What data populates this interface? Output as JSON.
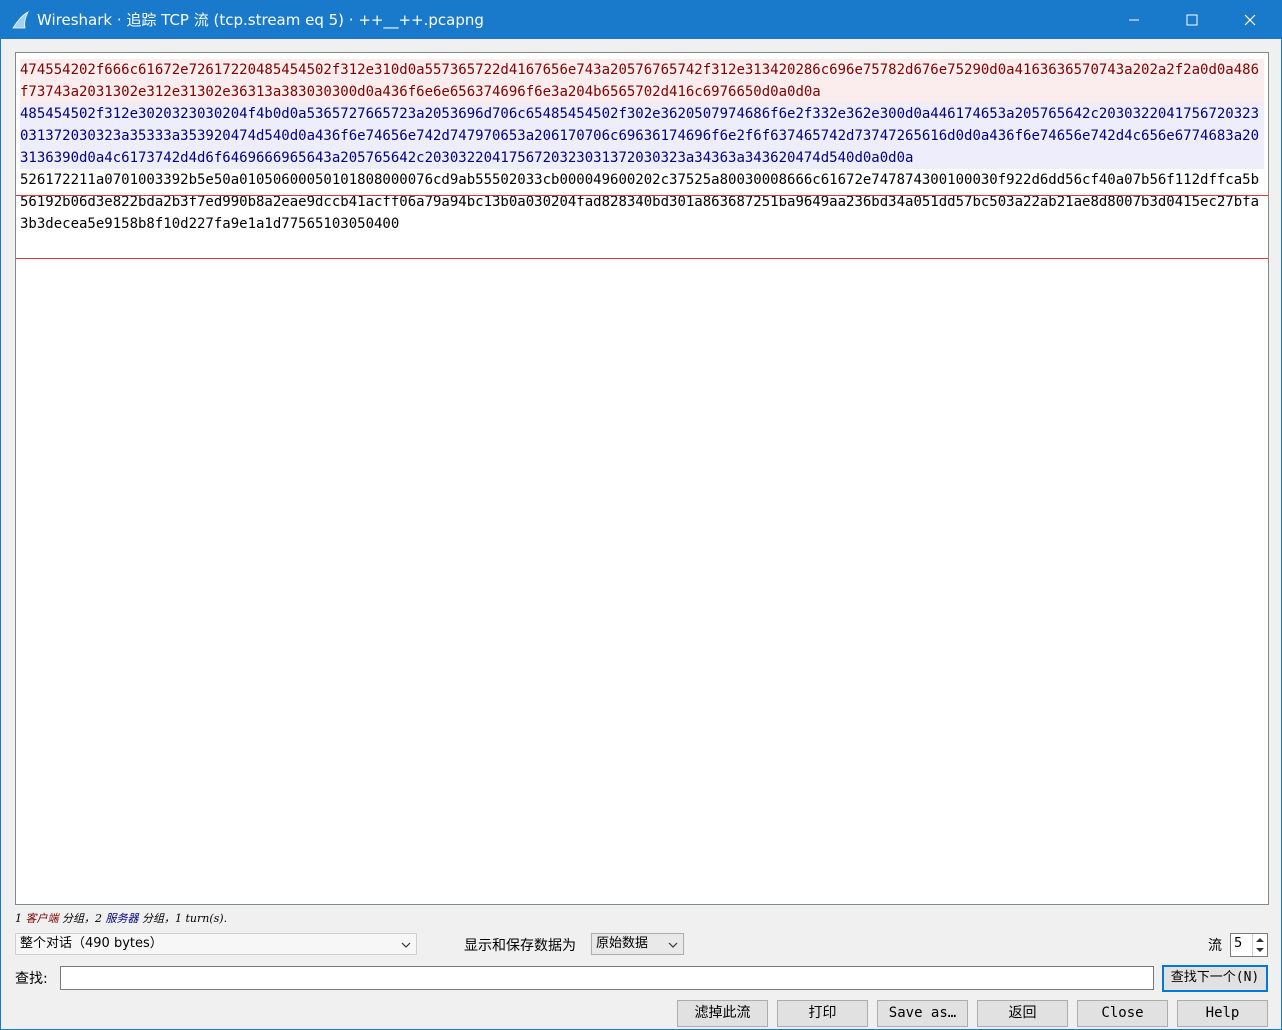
{
  "window": {
    "title": "Wireshark · 追踪 TCP 流 (tcp.stream eq 5) · ++__++.pcapng"
  },
  "stream": {
    "segments": [
      {
        "side": "client",
        "text": "474554202f666c61672e72617220485454502f312e310d0a557365722d4167656e743a20576765742f312e313420286c696e75782d676e75290d0a4163636570743a202a2f2a0d0a486f73743a2031302e312e31302e36313a383030300d0a436f6e6e656374696f6e3a204b6565702d416c6976650d0a0d0a"
      },
      {
        "side": "server",
        "text": "485454502f312e3020323030204f4b0d0a5365727665723a2053696d706c65485454502f302e3620507974686f6e2f332e362e300d0a446174653a205765642c2030322041756720323031372030323a35333a353920474d540d0a436f6e74656e742d747970653a206170706c69636174696f6e2f6f637465742d73747265616d0d0a436f6e74656e742d4c656e6774683a203136390d0a4c6173742d4d6f6469666965643a205765642c2030322041756720323031372030323a34363a343620474d540d0a0d0a"
      },
      {
        "side": "plain",
        "text": "526172211a0701003392b5e50a01050600050101808000076cd9ab55502033cb000049600202c37525a80030008666c61672e747874300100030f922d6dd56cf40a07b56f112dffca5b56192b06d3e822bda2b3f7ed990b8a2eae9dccb41acff06a79a94bc13b0a030204fad828340bd301a863687251ba9649aa236bd34a051dd57bc503a22ab21ae8d8007b3d0415ec27bfa3b3decea5e9158b8f10d227fa9e1a1d77565103050400"
      }
    ]
  },
  "summary": {
    "part1": "1 ",
    "client_word": "客户端",
    "part2": " 分组，2 ",
    "server_word": "服务器",
    "part3": " 分组，1 turn(s)."
  },
  "conversation_select": {
    "value": "整个对话（490 bytes）"
  },
  "format": {
    "label": "显示和保存数据为",
    "value": "原始数据"
  },
  "stream_selector": {
    "label": "流",
    "value": "5"
  },
  "find": {
    "label": "查找:",
    "value": "",
    "next_button": "查找下一个(N)"
  },
  "buttons": {
    "filter_out": "滤掉此流",
    "print": "打印",
    "save_as": "Save as…",
    "back": "返回",
    "close": "Close",
    "help": "Help"
  },
  "colors": {
    "titlebar": "#1979ca",
    "client_text": "#7f0000",
    "client_bg": "#fbeded",
    "server_text": "#00007f",
    "server_bg": "#ededfb",
    "annotation_box": "#e43a3a"
  }
}
